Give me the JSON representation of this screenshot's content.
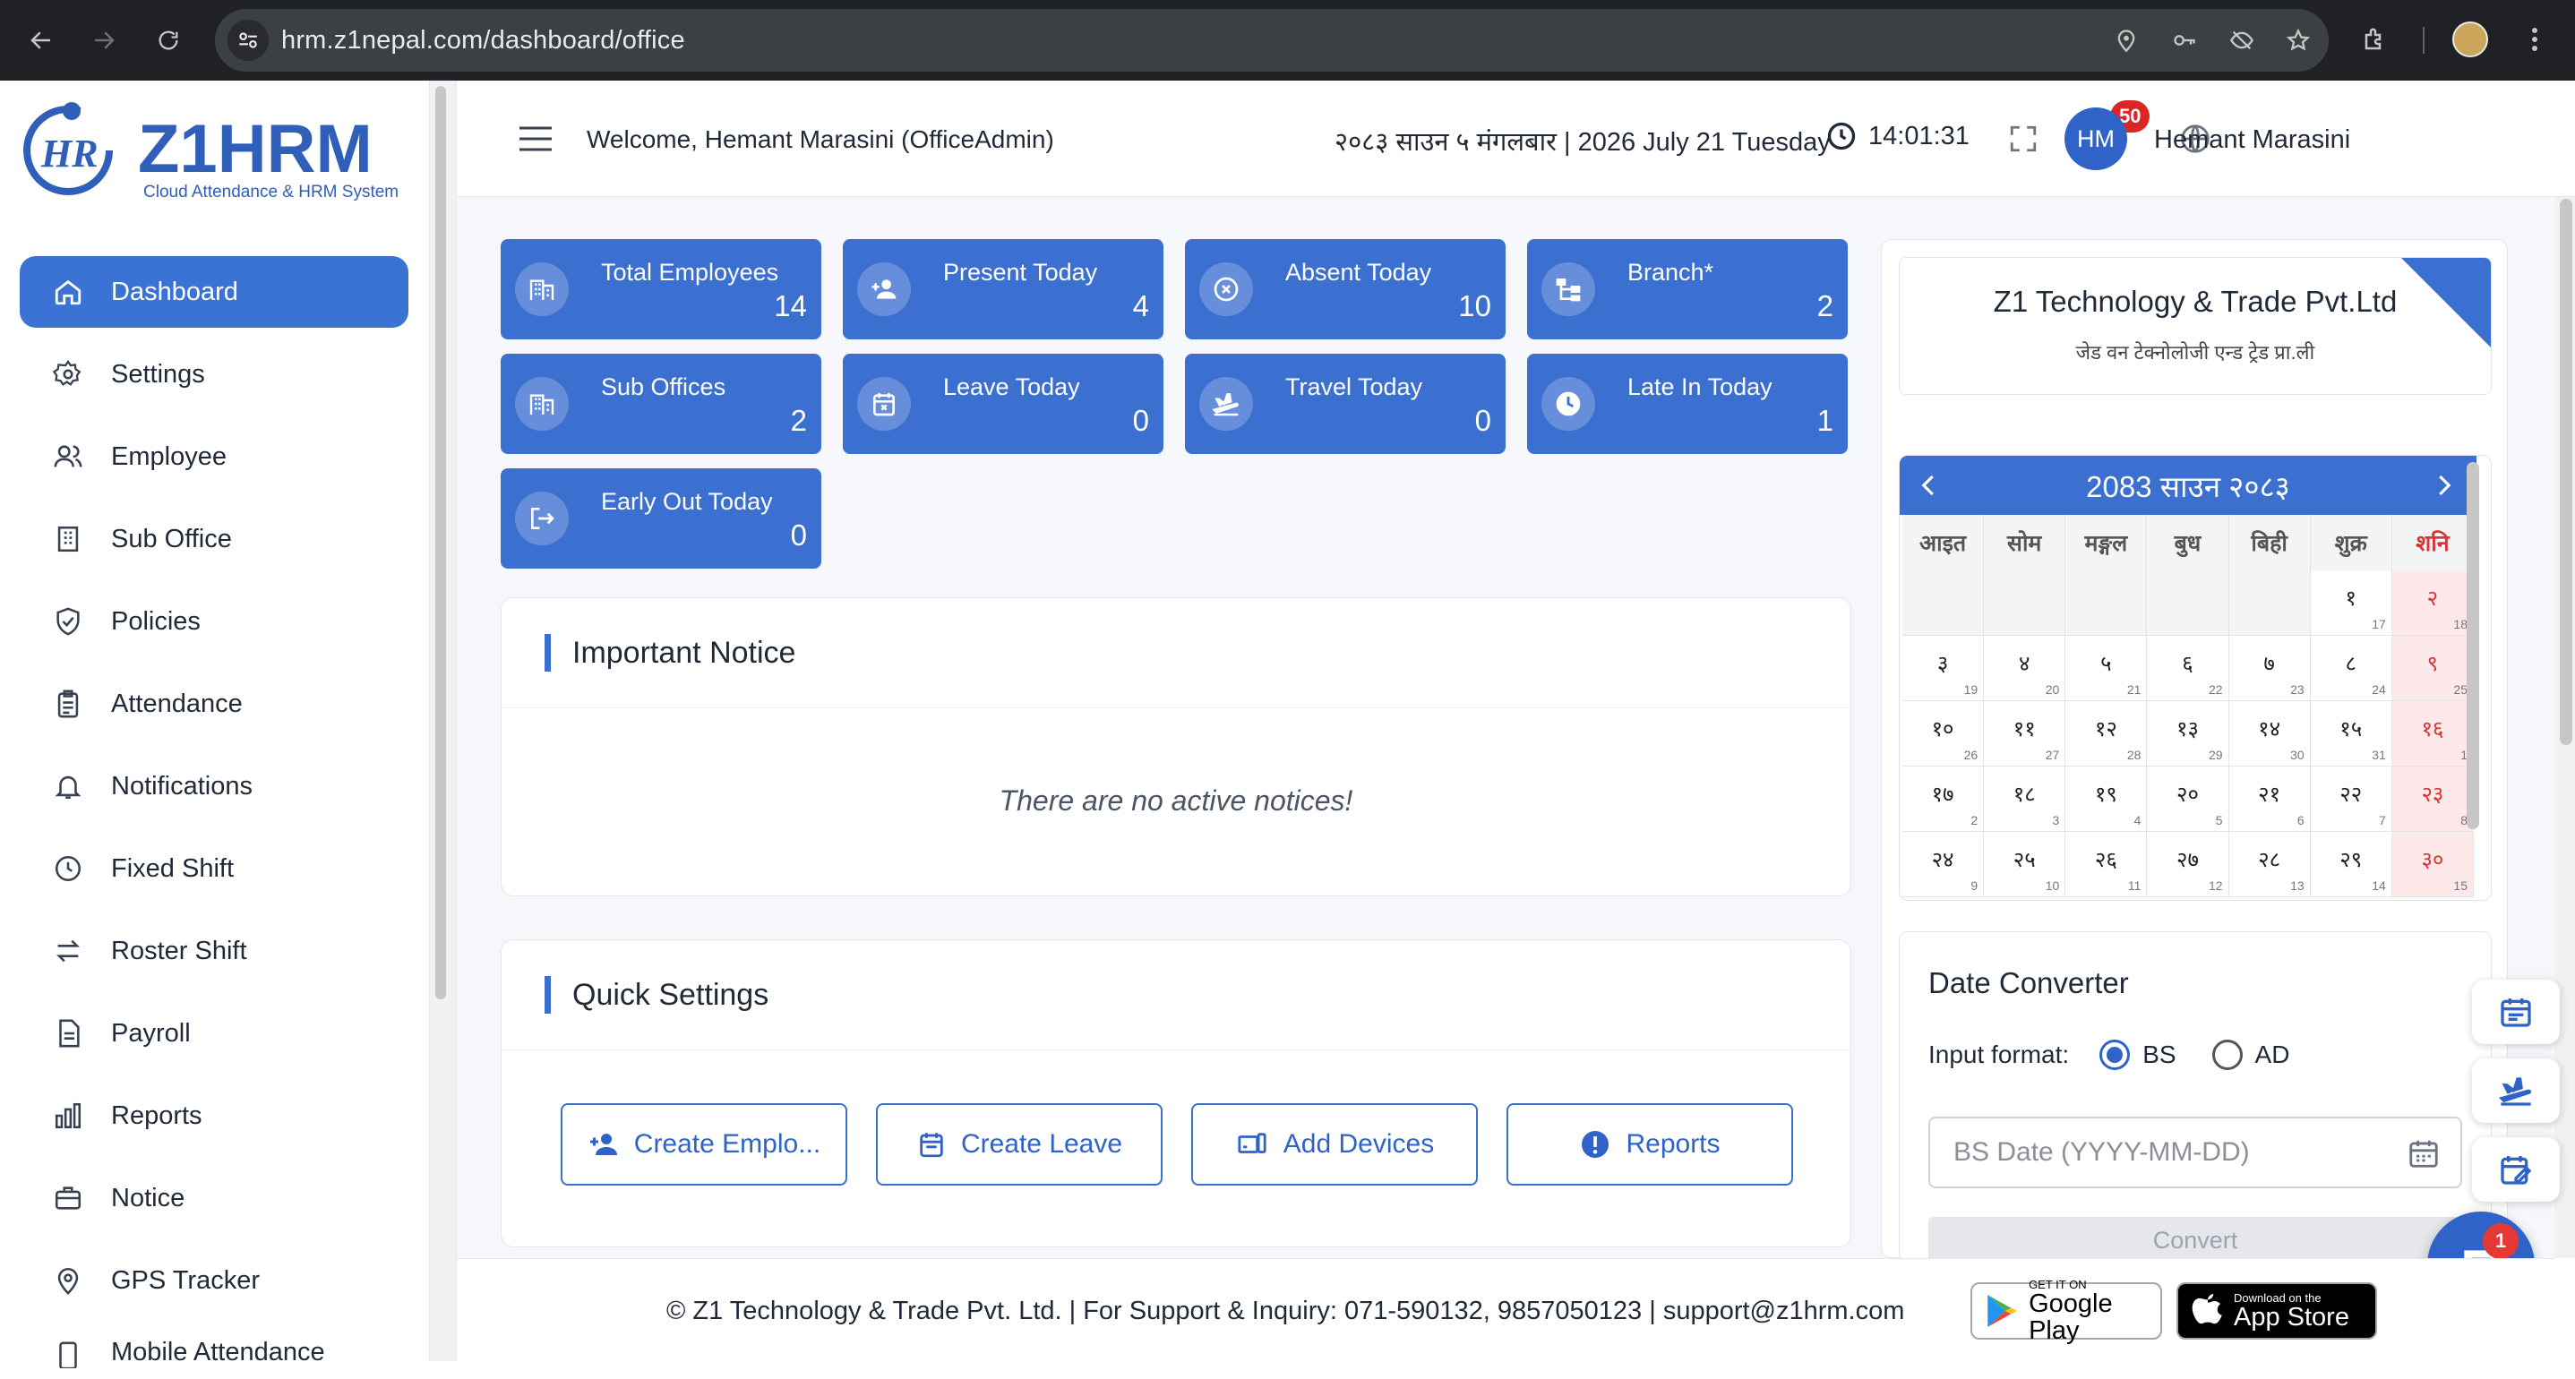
{
  "browser": {
    "url": "hrm.z1nepal.com/dashboard/office"
  },
  "brand": {
    "name": "Z1HRM",
    "tagline": "Cloud Attendance & HRM System",
    "accent": "#3b6fd0"
  },
  "sidebar": {
    "items": [
      {
        "label": "Dashboard",
        "icon": "home-icon",
        "active": true
      },
      {
        "label": "Settings",
        "icon": "gear-icon"
      },
      {
        "label": "Employee",
        "icon": "users-icon"
      },
      {
        "label": "Sub Office",
        "icon": "building-icon"
      },
      {
        "label": "Policies",
        "icon": "shield-check-icon"
      },
      {
        "label": "Attendance",
        "icon": "clipboard-icon"
      },
      {
        "label": "Notifications",
        "icon": "bell-icon"
      },
      {
        "label": "Fixed Shift",
        "icon": "clock-icon"
      },
      {
        "label": "Roster Shift",
        "icon": "swap-icon"
      },
      {
        "label": "Payroll",
        "icon": "document-icon"
      },
      {
        "label": "Reports",
        "icon": "bar-chart-icon"
      },
      {
        "label": "Notice",
        "icon": "briefcase-icon"
      },
      {
        "label": "GPS Tracker",
        "icon": "map-pin-icon"
      },
      {
        "label": "Mobile Attendance",
        "icon": "phone-icon"
      }
    ]
  },
  "header": {
    "welcome": "Welcome, Hemant Marasini (OfficeAdmin)",
    "date": "२०८३ साउन ५ मंगलबार | 2026 July 21 Tuesday",
    "time": "14:01:31",
    "notification_count": "50",
    "user_initials": "HM",
    "user_name": "Hemant Marasini"
  },
  "stats": [
    {
      "label": "Total Employees",
      "value": "14",
      "icon": "building-icon"
    },
    {
      "label": "Present Today",
      "value": "4",
      "icon": "person-add-icon"
    },
    {
      "label": "Absent Today",
      "value": "10",
      "icon": "x-circle-icon"
    },
    {
      "label": "Branch*",
      "value": "2",
      "icon": "hierarchy-icon"
    },
    {
      "label": "Sub Offices",
      "value": "2",
      "icon": "building-icon"
    },
    {
      "label": "Leave Today",
      "value": "0",
      "icon": "calendar-x-icon"
    },
    {
      "label": "Travel Today",
      "value": "0",
      "icon": "plane-icon"
    },
    {
      "label": "Late In Today",
      "value": "1",
      "icon": "clock-icon"
    },
    {
      "label": "Early Out Today",
      "value": "0",
      "icon": "logout-icon"
    }
  ],
  "notice": {
    "title": "Important Notice",
    "empty": "There are no active notices!"
  },
  "quick_settings": {
    "title": "Quick Settings",
    "buttons": [
      "Create Emplo...",
      "Create Leave",
      "Add Devices",
      "Reports"
    ]
  },
  "company": {
    "name": "Z1 Technology & Trade Pvt.Ltd",
    "name_np": "जेड वन टेक्नोलोजी एन्ड ट्रेड प्रा.ली"
  },
  "calendar": {
    "title": "2083 साउन २०८३",
    "weekdays": [
      "आइत",
      "सोम",
      "मङ्गल",
      "बुध",
      "बिही",
      "शुक्र",
      "शनि"
    ],
    "weeks": [
      [
        null,
        null,
        null,
        null,
        null,
        {
          "np": "१",
          "ad": "17"
        },
        {
          "np": "२",
          "ad": "18"
        }
      ],
      [
        {
          "np": "३",
          "ad": "19"
        },
        {
          "np": "४",
          "ad": "20"
        },
        {
          "np": "५",
          "ad": "21"
        },
        {
          "np": "६",
          "ad": "22"
        },
        {
          "np": "७",
          "ad": "23"
        },
        {
          "np": "८",
          "ad": "24"
        },
        {
          "np": "९",
          "ad": "25"
        }
      ],
      [
        {
          "np": "१०",
          "ad": "26"
        },
        {
          "np": "११",
          "ad": "27"
        },
        {
          "np": "१२",
          "ad": "28"
        },
        {
          "np": "१३",
          "ad": "29"
        },
        {
          "np": "१४",
          "ad": "30"
        },
        {
          "np": "१५",
          "ad": "31"
        },
        {
          "np": "१६",
          "ad": "1"
        }
      ],
      [
        {
          "np": "१७",
          "ad": "2"
        },
        {
          "np": "१८",
          "ad": "3"
        },
        {
          "np": "१९",
          "ad": "4"
        },
        {
          "np": "२०",
          "ad": "5"
        },
        {
          "np": "२१",
          "ad": "6"
        },
        {
          "np": "२२",
          "ad": "7"
        },
        {
          "np": "२३",
          "ad": "8"
        }
      ],
      [
        {
          "np": "२४",
          "ad": "9"
        },
        {
          "np": "२५",
          "ad": "10"
        },
        {
          "np": "२६",
          "ad": "11"
        },
        {
          "np": "२७",
          "ad": "12"
        },
        {
          "np": "२८",
          "ad": "13"
        },
        {
          "np": "२९",
          "ad": "14"
        },
        {
          "np": "३०",
          "ad": "15"
        }
      ]
    ]
  },
  "converter": {
    "title": "Date Converter",
    "format_label": "Input format:",
    "opt_bs": "BS",
    "opt_ad": "AD",
    "selected": "BS",
    "placeholder": "BS Date (YYYY-MM-DD)",
    "button": "Convert"
  },
  "chat": {
    "badge": "1"
  },
  "footer": {
    "text": "© Z1 Technology & Trade Pvt. Ltd. | For Support & Inquiry: 071-590132, 9857050123 | support@z1hrm.com",
    "google_small": "GET IT ON",
    "google_big": "Google Play",
    "apple_small": "Download on the",
    "apple_big": "App Store"
  }
}
